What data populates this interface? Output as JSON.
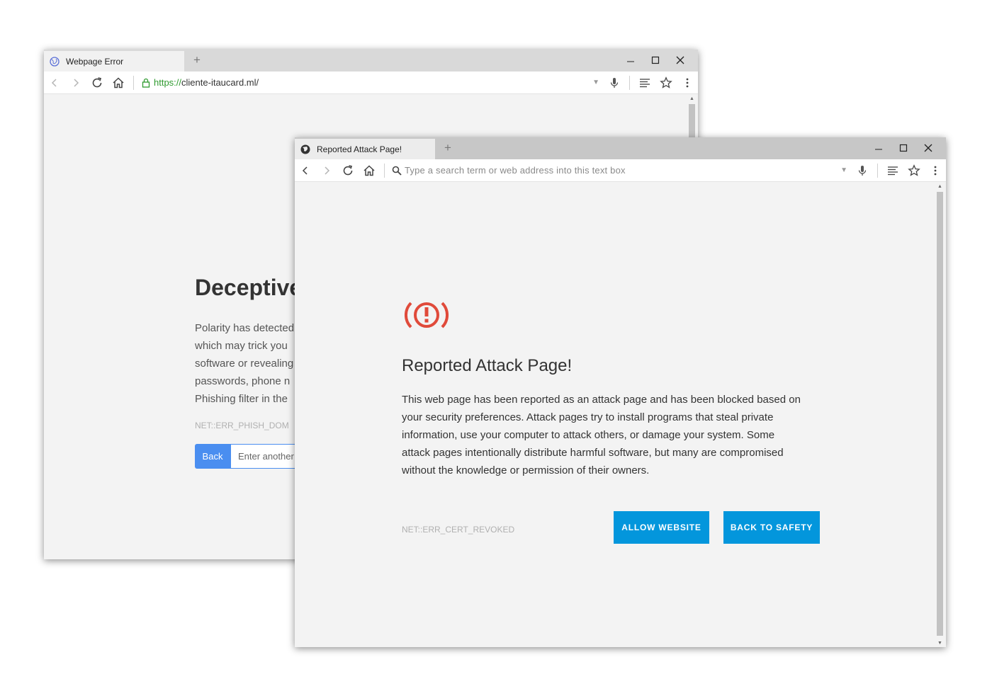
{
  "back_window": {
    "tab_title": "Webpage Error",
    "new_tab": "+",
    "url_scheme": "https://",
    "url_rest": "cliente-itaucard.ml/",
    "heading": "Deceptive",
    "body_lines": [
      "Polarity has detected",
      "which may trick you",
      "software or revealing",
      "passwords, phone n",
      "Phishing filter in the"
    ],
    "error_code": "NET::ERR_PHISH_DOM",
    "back_button": "Back",
    "input_value": "Enter another"
  },
  "front_window": {
    "tab_title": "Reported Attack Page!",
    "new_tab": "+",
    "search_placeholder": "Type a search term or web address into this text box",
    "heading": "Reported Attack Page!",
    "body_lines": [
      "This web page has been reported as an attack page and has been blocked based on",
      "your security preferences. Attack pages try to install programs that steal private",
      "information, use your computer to attack others, or damage your system. Some",
      "attack pages intentionally distribute harmful software, but many are compromised",
      "without the knowledge or permission of their owners."
    ],
    "error_code": "NET::ERR_CERT_REVOKED",
    "allow_button": "ALLOW WEBSITE",
    "safety_button": "BACK TO SAFETY"
  },
  "colors": {
    "warning_red": "#e04a3a",
    "button_blue": "#0396dc",
    "back_button_blue": "#4a8ef0",
    "secure_green": "#2f9a2f"
  },
  "icons": [
    "globe-icon",
    "minimize-icon",
    "maximize-icon",
    "close-icon",
    "back-arrow-icon",
    "forward-arrow-icon",
    "reload-icon",
    "home-icon",
    "lock-icon",
    "search-icon",
    "dropdown-icon",
    "microphone-icon",
    "reader-icon",
    "star-icon",
    "menu-icon",
    "warning-icon"
  ]
}
